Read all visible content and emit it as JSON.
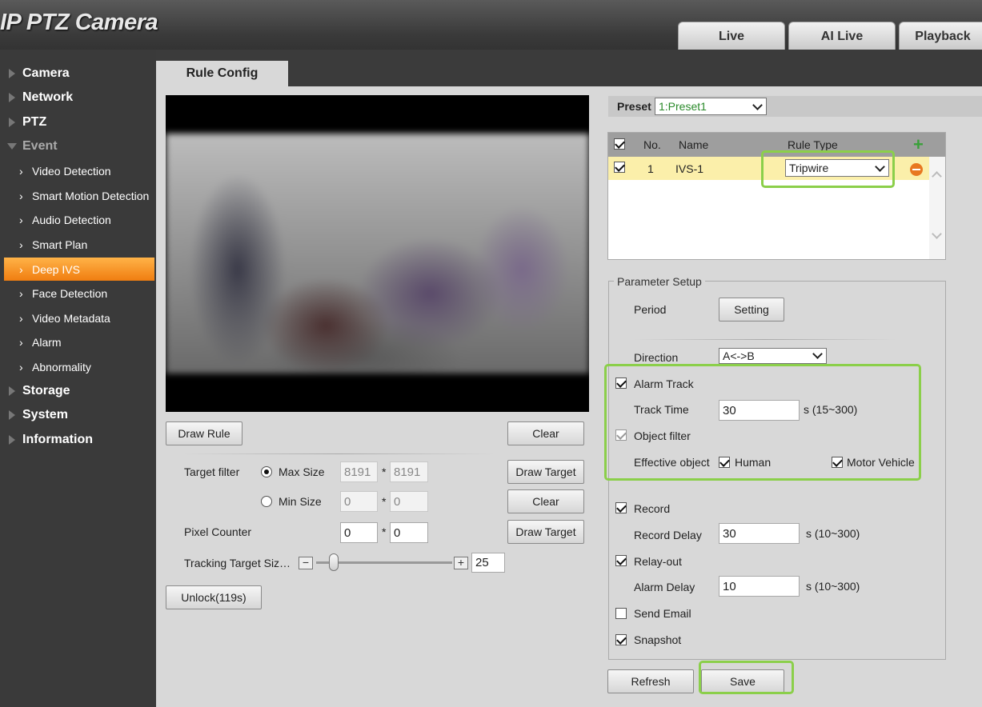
{
  "header": {
    "logo": "IP PTZ Camera",
    "tabs": [
      {
        "label": "Live"
      },
      {
        "label": "AI Live"
      },
      {
        "label": "Playback"
      }
    ]
  },
  "page_tab": "Rule Config",
  "sidebar": {
    "camera": "Camera",
    "network": "Network",
    "ptz": "PTZ",
    "event": "Event",
    "event_items": [
      "Video Detection",
      "Smart Motion Detection",
      "Audio Detection",
      "Smart Plan",
      "Deep IVS",
      "Face Detection",
      "Video Metadata",
      "Alarm",
      "Abnormality"
    ],
    "storage": "Storage",
    "system": "System",
    "information": "Information"
  },
  "left": {
    "draw_rule": "Draw Rule",
    "clear": "Clear",
    "target_filter": "Target filter",
    "max_size": "Max Size",
    "min_size": "Min Size",
    "max_w": "8191",
    "max_h": "8191",
    "min_w": "0",
    "min_h": "0",
    "star": "*",
    "draw_target": "Draw Target",
    "pixel_counter": "Pixel Counter",
    "pixel_w": "0",
    "pixel_h": "0",
    "tracking_target_size": "Tracking Target Siz…",
    "minus": "−",
    "plus": "+",
    "tracking_value": "25",
    "tracking_fraction": 0.13,
    "unlock": "Unlock(119s)"
  },
  "right": {
    "preset_label": "Preset",
    "preset_value": "1:Preset1",
    "table": {
      "headers": {
        "no": "No.",
        "name": "Name",
        "rule_type": "Rule Type"
      },
      "rows": [
        {
          "no": "1",
          "name": "IVS-1",
          "rule_type": "Tripwire"
        }
      ]
    },
    "param_title": "Parameter Setup",
    "period": "Period",
    "setting": "Setting",
    "direction": "Direction",
    "direction_value": "A<->B",
    "alarm_track": "Alarm Track",
    "track_time": "Track Time",
    "track_time_value": "30",
    "track_time_range": "s (15~300)",
    "object_filter": "Object filter",
    "effective_object": "Effective object",
    "human": "Human",
    "motor_vehicle": "Motor Vehicle",
    "record": "Record",
    "record_delay": "Record Delay",
    "record_delay_value": "30",
    "record_delay_range": "s (10~300)",
    "relay_out": "Relay-out",
    "alarm_delay": "Alarm Delay",
    "alarm_delay_value": "10",
    "alarm_delay_range": "s (10~300)",
    "send_email": "Send Email",
    "snapshot": "Snapshot",
    "refresh": "Refresh",
    "save": "Save"
  },
  "colors": {
    "active_nav": "#f5901c",
    "highlight": "#8bcf4a",
    "selected_row": "#fbefaa",
    "preset_text": "#2a8a2a"
  }
}
